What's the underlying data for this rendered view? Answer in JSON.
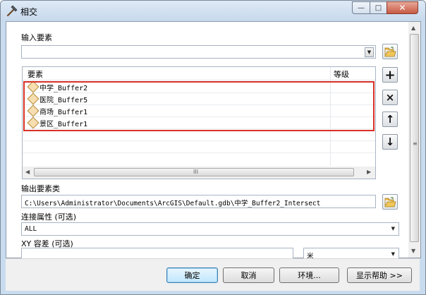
{
  "window": {
    "title": "相交",
    "min_glyph": "—",
    "max_glyph": "□",
    "close_glyph": "✕"
  },
  "input_features": {
    "label": "输入要素",
    "value": "",
    "list_header": {
      "feature": "要素",
      "rank": "等级"
    },
    "rows": [
      {
        "name": "中学_Buffer2",
        "rank": ""
      },
      {
        "name": "医院_Buffer5",
        "rank": ""
      },
      {
        "name": "商场_Buffer1",
        "rank": ""
      },
      {
        "name": "景区_Buffer1",
        "rank": ""
      }
    ],
    "scroll_grip": "III",
    "tools": {
      "add": "+",
      "remove": "×",
      "up": "↑",
      "down": "↓"
    }
  },
  "output": {
    "label": "输出要素类",
    "value": "C:\\Users\\Administrator\\Documents\\ArcGIS\\Default.gdb\\中学_Buffer2_Intersect"
  },
  "join_attributes": {
    "label": "连接属性 (可选)",
    "value": "ALL"
  },
  "xy_tolerance": {
    "label": "XY 容差 (可选)",
    "value": "",
    "unit": "米"
  },
  "buttons": {
    "ok": "确定",
    "cancel": "取消",
    "environments": "环境...",
    "show_help": "显示帮助 >>"
  },
  "icons": {
    "app": "hammer-icon",
    "folder": "open-folder-icon",
    "feature": "polygon-feature-icon"
  }
}
